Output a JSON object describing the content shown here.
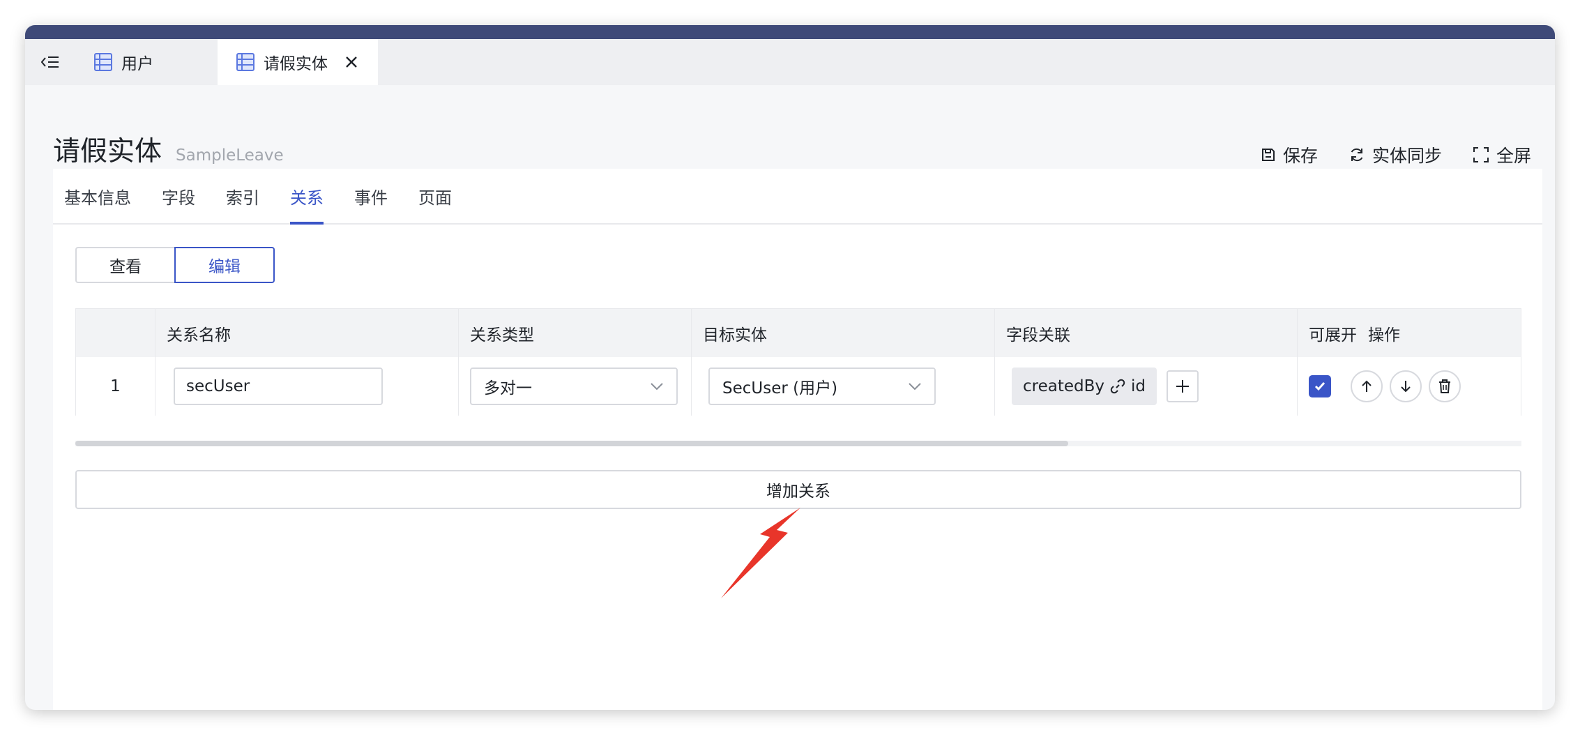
{
  "tabs": [
    {
      "label": "用户",
      "icon": "table-icon"
    },
    {
      "label": "请假实体",
      "icon": "table-icon"
    }
  ],
  "header": {
    "title": "请假实体",
    "subtitle": "SampleLeave",
    "actions": {
      "save": "保存",
      "sync": "实体同步",
      "fullscreen": "全屏"
    }
  },
  "panel_tabs": [
    "基本信息",
    "字段",
    "索引",
    "关系",
    "事件",
    "页面"
  ],
  "active_panel_tab": "关系",
  "mode_toggle": {
    "view": "查看",
    "edit": "编辑",
    "selected": "编辑"
  },
  "table": {
    "columns": [
      "关系名称",
      "关系类型",
      "目标实体",
      "字段关联",
      "可展开",
      "操作"
    ],
    "rows": [
      {
        "index": "1",
        "name": "secUser",
        "type": "多对一",
        "target": "SecUser (用户)",
        "field_link": {
          "source": "createdBy",
          "target": "id"
        },
        "expandable": true
      }
    ]
  },
  "add_button": "增加关系",
  "colors": {
    "accent": "#3a55c7",
    "topbar": "#3f4a78",
    "annotation_arrow": "#e8352a"
  }
}
